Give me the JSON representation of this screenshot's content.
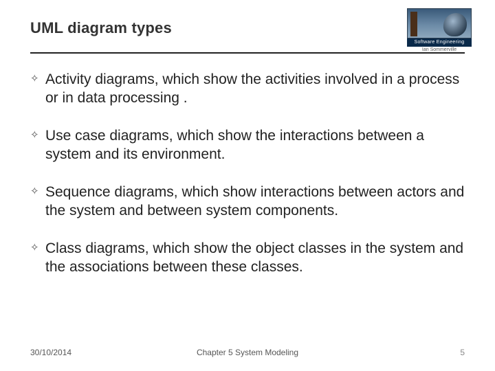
{
  "title": "UML diagram types",
  "logo": {
    "bar": "Software Engineering",
    "sub": "Ian Sommerville"
  },
  "bullets": [
    "Activity diagrams, which show the activities involved in a process or in data processing .",
    "Use case diagrams, which show the interactions between a system and its environment.",
    "Sequence diagrams, which show interactions between actors and the system and between system components.",
    "Class diagrams, which show the object classes in the system and the associations between these classes."
  ],
  "footer": {
    "date": "30/10/2014",
    "chapter": "Chapter 5 System Modeling",
    "page": "5"
  }
}
